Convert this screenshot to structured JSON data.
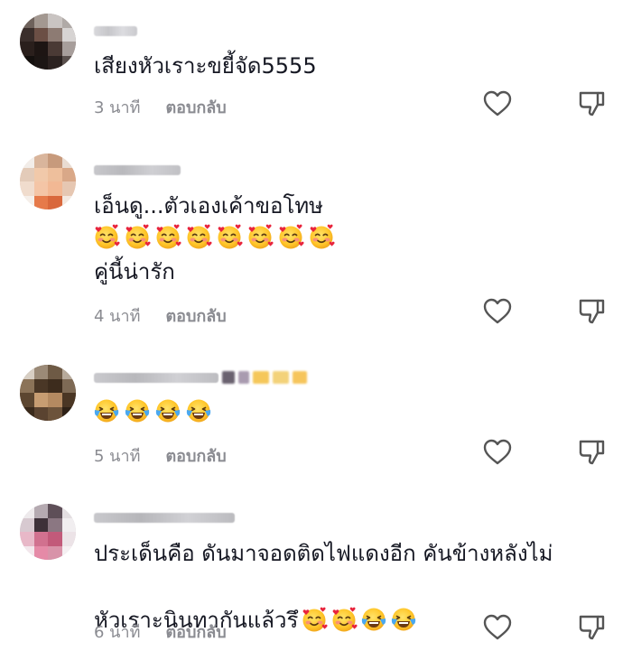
{
  "comments": [
    {
      "id": 1,
      "text": "เสียงหัวเราะขยี้จัด5555",
      "time": "3 นาที",
      "reply_label": "ตอบกลับ",
      "emojis": [],
      "extra_text": ""
    },
    {
      "id": 2,
      "text": "เอ็นดู...ตัวเองเค้าขอโทษ",
      "time": "4 นาที",
      "reply_label": "ตอบกลับ",
      "emojis": [
        "smiling-face-with-hearts",
        "smiling-face-with-hearts",
        "smiling-face-with-hearts",
        "smiling-face-with-hearts",
        "smiling-face-with-hearts",
        "smiling-face-with-hearts",
        "smiling-face-with-hearts",
        "smiling-face-with-hearts"
      ],
      "extra_text": "คู่นี้น่ารัก"
    },
    {
      "id": 3,
      "text": "",
      "time": "5 นาที",
      "reply_label": "ตอบกลับ",
      "emojis": [
        "face-with-tears-of-joy",
        "face-with-tears-of-joy",
        "face-with-tears-of-joy",
        "face-with-tears-of-joy"
      ],
      "extra_text": ""
    },
    {
      "id": 4,
      "text_line1": "ประเด็นคือ ดันมาจอดติดไฟแดงอีก คันข้างหลังไม่",
      "text_line2": "หัวเราะนินทากันแล้วรึ",
      "time": "6 นาที",
      "reply_label": "ตอบกลับ",
      "emojis": [
        "smiling-face-with-hearts",
        "smiling-face-with-hearts",
        "face-with-tears-of-joy",
        "face-with-tears-of-joy"
      ]
    }
  ],
  "colors": {
    "text": "#161823",
    "meta": "#8a8b91",
    "icon": "#555555"
  }
}
